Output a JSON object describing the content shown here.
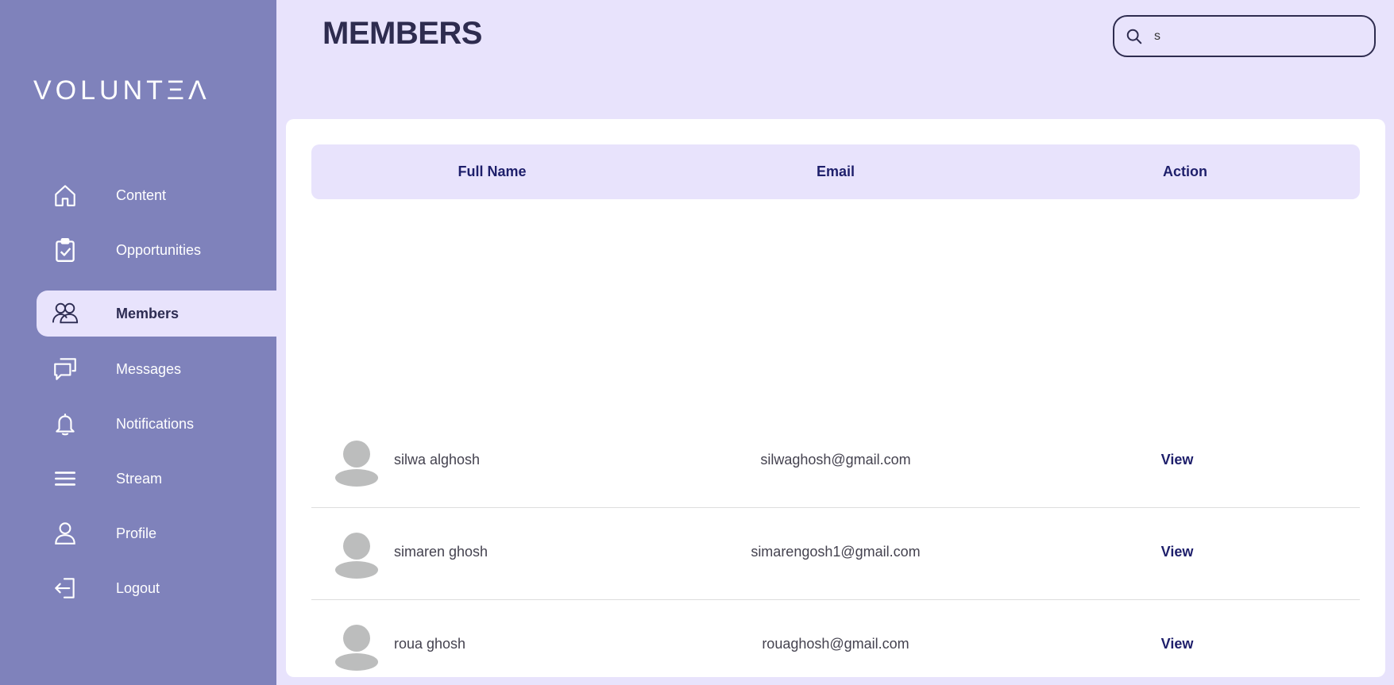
{
  "brand": {
    "logo_text": "VOLUNTΞΛ"
  },
  "sidebar": {
    "items": [
      {
        "label": "Content",
        "icon": "home-icon"
      },
      {
        "label": "Opportunities",
        "icon": "clipboard-check-icon"
      },
      {
        "label": "Members",
        "icon": "users-icon",
        "active": true
      },
      {
        "label": "Messages",
        "icon": "chat-icon"
      },
      {
        "label": "Notifications",
        "icon": "bell-icon"
      },
      {
        "label": "Stream",
        "icon": "menu-icon"
      },
      {
        "label": "Profile",
        "icon": "user-icon"
      },
      {
        "label": "Logout",
        "icon": "logout-icon"
      }
    ]
  },
  "header": {
    "title": "MEMBERS",
    "search": {
      "value": "s",
      "placeholder": ""
    }
  },
  "table": {
    "columns": [
      "Full Name",
      "Email",
      "Action"
    ],
    "rows": [
      {
        "name": "silwa alghosh",
        "email": "silwaghosh@gmail.com",
        "action": "View"
      },
      {
        "name": "simaren ghosh",
        "email": "simarengosh1@gmail.com",
        "action": "View"
      },
      {
        "name": "roua ghosh",
        "email": "rouaghosh@gmail.com",
        "action": "View"
      }
    ]
  },
  "colors": {
    "sidebar": "#7f82bb",
    "background": "#e8e3fc",
    "accent": "#1e1f6b",
    "title": "#2e2c4f"
  }
}
